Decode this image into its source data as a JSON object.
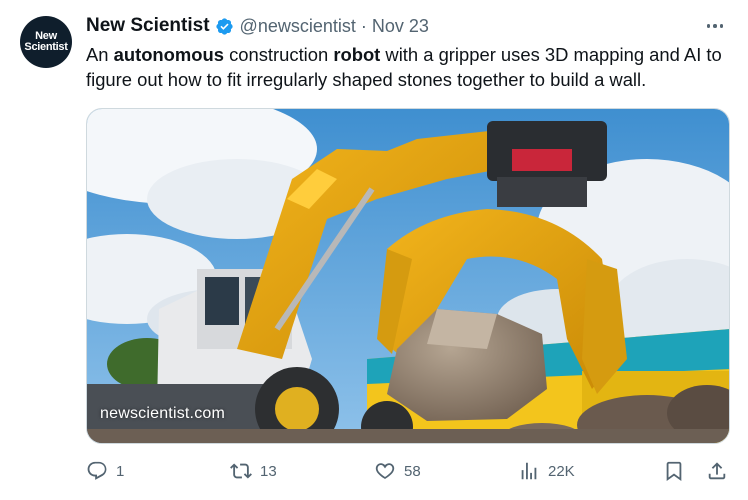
{
  "avatar": {
    "line1": "New",
    "line2": "Scientist"
  },
  "author": {
    "name": "New Scientist",
    "handle": "@newscientist",
    "separator": "·",
    "date": "Nov 23"
  },
  "tweet": {
    "text_parts": [
      "An ",
      "autonomous",
      " construction ",
      "robot",
      " with a gripper uses 3D mapping and AI to figure out how to fit irregularly shaped stones together to build a wall."
    ]
  },
  "media": {
    "watermark": "newscientist.com"
  },
  "actions": {
    "reply_count": "1",
    "retweet_count": "13",
    "like_count": "58",
    "views_count": "22K"
  },
  "colors": {
    "text": "#0f1419",
    "muted": "#536471",
    "verified": "#1d9bf0",
    "border": "#cfd9de"
  },
  "icons": [
    "verified-badge-icon",
    "more-icon",
    "reply-icon",
    "retweet-icon",
    "like-icon",
    "views-icon",
    "bookmark-icon",
    "share-icon"
  ]
}
